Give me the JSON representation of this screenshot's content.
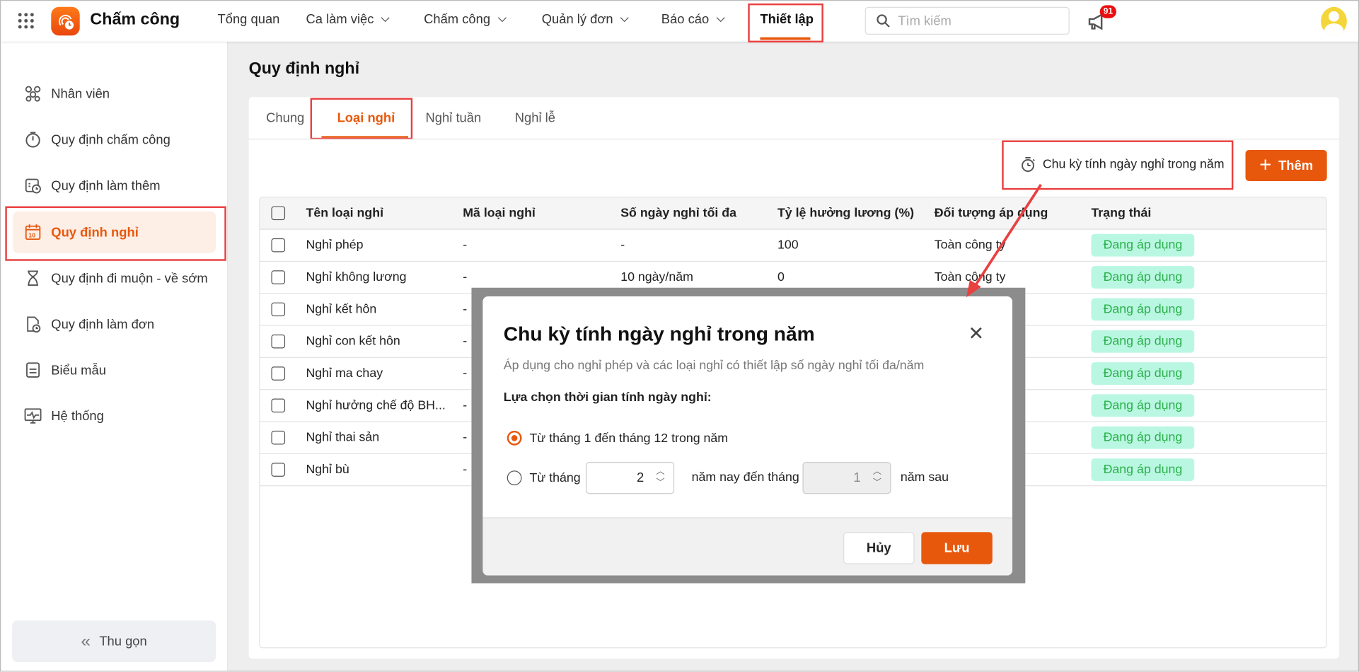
{
  "header": {
    "app_name": "Chấm công",
    "nav": [
      {
        "label": "Tổng quan",
        "dropdown": false
      },
      {
        "label": "Ca làm việc",
        "dropdown": true
      },
      {
        "label": "Chấm công",
        "dropdown": true
      },
      {
        "label": "Quản lý đơn",
        "dropdown": true
      },
      {
        "label": "Báo cáo",
        "dropdown": true
      },
      {
        "label": "Thiết lập",
        "dropdown": false,
        "active": true
      }
    ],
    "search_placeholder": "Tìm kiếm",
    "notification_count": "91"
  },
  "sidebar": {
    "items": [
      {
        "label": "Nhân viên",
        "icon": "users-icon"
      },
      {
        "label": "Quy định chấm công",
        "icon": "stopwatch-icon"
      },
      {
        "label": "Quy định làm thêm",
        "icon": "calendar-clock-icon"
      },
      {
        "label": "Quy định nghỉ",
        "icon": "calendar-icon",
        "active": true
      },
      {
        "label": "Quy định đi muộn - về sớm",
        "icon": "hourglass-icon"
      },
      {
        "label": "Quy định làm đơn",
        "icon": "document-clock-icon"
      },
      {
        "label": "Biểu mẫu",
        "icon": "form-icon"
      },
      {
        "label": "Hệ thống",
        "icon": "monitor-icon"
      }
    ],
    "collapse_label": "Thu gọn"
  },
  "page": {
    "title": "Quy định nghỉ",
    "tabs": [
      "Chung",
      "Loại nghỉ",
      "Nghỉ tuần",
      "Nghỉ lễ"
    ],
    "active_tab": 1,
    "cycle_button": "Chu kỳ tính ngày nghỉ trong năm",
    "add_button": "Thêm"
  },
  "table": {
    "columns": [
      "Tên loại nghỉ",
      "Mã loại nghỉ",
      "Số ngày nghỉ tối đa",
      "Tỷ lệ hưởng lương (%)",
      "Đối tượng áp dụng",
      "Trạng thái"
    ],
    "rows": [
      [
        "Nghỉ phép",
        "-",
        "-",
        "100",
        "Toàn công ty",
        "Đang áp dụng"
      ],
      [
        "Nghỉ không lương",
        "-",
        "10 ngày/năm",
        "0",
        "Toàn công ty",
        "Đang áp dụng"
      ],
      [
        "Nghỉ kết hôn",
        "-",
        "",
        "",
        "",
        "Đang áp dụng"
      ],
      [
        "Nghỉ con kết hôn",
        "-",
        "",
        "",
        "",
        "Đang áp dụng"
      ],
      [
        "Nghỉ ma chay",
        "-",
        "",
        "",
        "",
        "Đang áp dụng"
      ],
      [
        "Nghỉ hưởng chế độ BH...",
        "-",
        "",
        "",
        "",
        "Đang áp dụng"
      ],
      [
        "Nghỉ thai sản",
        "-",
        "",
        "",
        "",
        "Đang áp dụng"
      ],
      [
        "Nghỉ bù",
        "-",
        "",
        "",
        "",
        "Đang áp dụng"
      ]
    ]
  },
  "dialog": {
    "title": "Chu kỳ tính ngày nghỉ trong năm",
    "subtitle": "Áp dụng cho nghỉ phép và các loại nghỉ có thiết lập số ngày nghỉ tối đa/năm",
    "section_label": "Lựa chọn thời gian tính ngày nghỉ:",
    "option1": "Từ tháng 1 đến tháng 12 trong năm",
    "option2_prefix": "Từ tháng",
    "from_month": "2",
    "option2_middle": "năm nay đến tháng",
    "to_month": "1",
    "option2_suffix": "năm sau",
    "selected_option": 1,
    "cancel": "Hủy",
    "save": "Lưu"
  },
  "colors": {
    "accent": "#e8580c",
    "badge_bg": "#baf7e2",
    "badge_text": "#2bb14b",
    "highlight": "#e94040"
  }
}
